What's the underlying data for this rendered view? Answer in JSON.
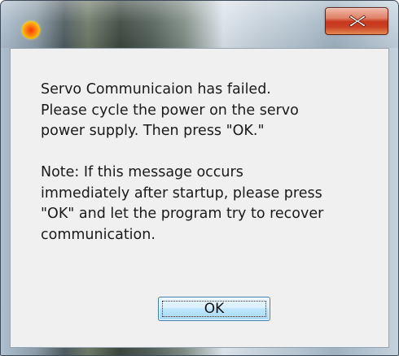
{
  "window": {
    "app_icon": "orange-circle-icon",
    "close_icon": "close-icon",
    "close_glyph": "x"
  },
  "message": {
    "paragraph1": [
      "Servo Communicaion has failed.",
      "Please cycle the power on the servo",
      "power supply.  Then press \"OK.\""
    ],
    "paragraph2": [
      "Note: If this message occurs",
      "immediately after startup, please press",
      "\"OK\" and let the program try to recover",
      "communication."
    ]
  },
  "buttons": {
    "ok_label": "OK"
  },
  "colors": {
    "client_background": "#f0f0f0",
    "close_button": "#c8371d",
    "ok_button": "#bee6fd"
  }
}
